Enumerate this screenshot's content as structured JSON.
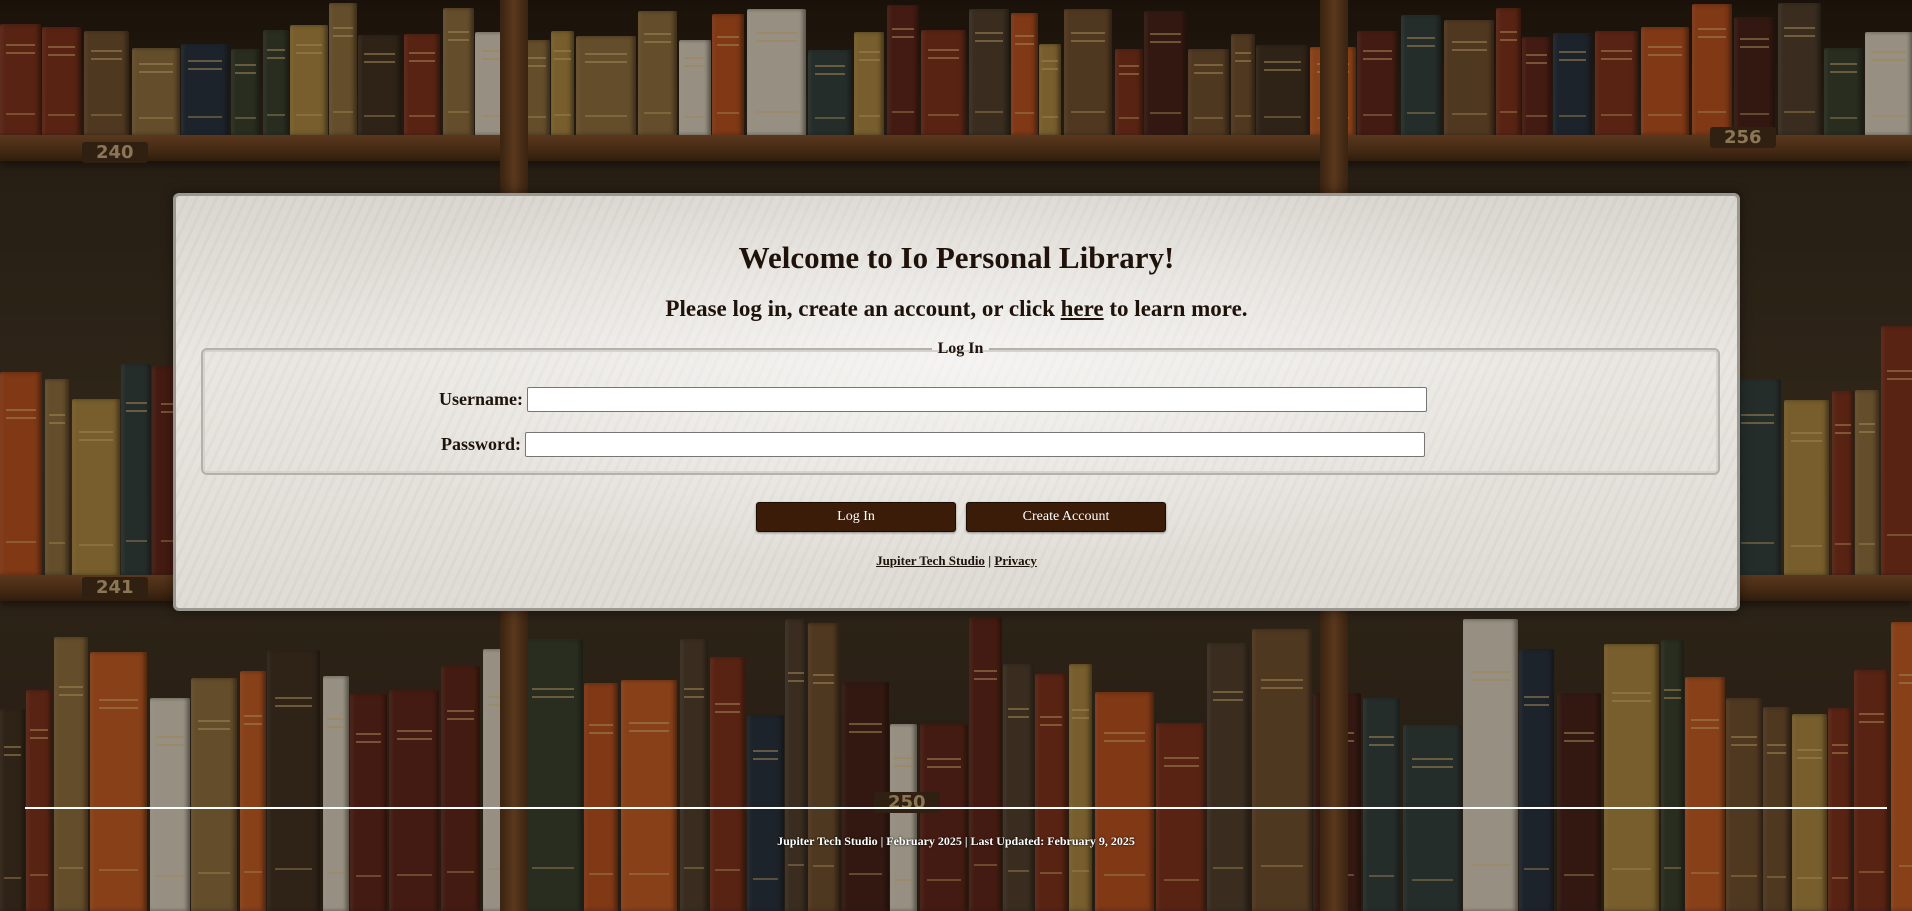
{
  "header": {
    "title": "Welcome to Io Personal Library!",
    "subtitle_before": "Please log in, create an account, or click",
    "subtitle_link": "here",
    "subtitle_after": "to learn more."
  },
  "login_form": {
    "legend": "Log In",
    "username_label": "Username:",
    "username_value": "",
    "password_label": "Password:",
    "password_value": ""
  },
  "buttons": {
    "login_label": "Log In",
    "create_account_label": "Create Account"
  },
  "panel_links": {
    "studio": "Jupiter Tech Studio",
    "separator": "|",
    "privacy": "Privacy"
  },
  "footer": {
    "text": "Jupiter Tech Studio | February 2025 | Last Updated: February 9, 2025"
  },
  "background": {
    "shelf_labels": [
      "240",
      "256",
      "241",
      "250"
    ]
  },
  "colors": {
    "button_bg": "#3a1c08",
    "text": "#1e120a",
    "panel_bg": "#e6e2dc"
  }
}
